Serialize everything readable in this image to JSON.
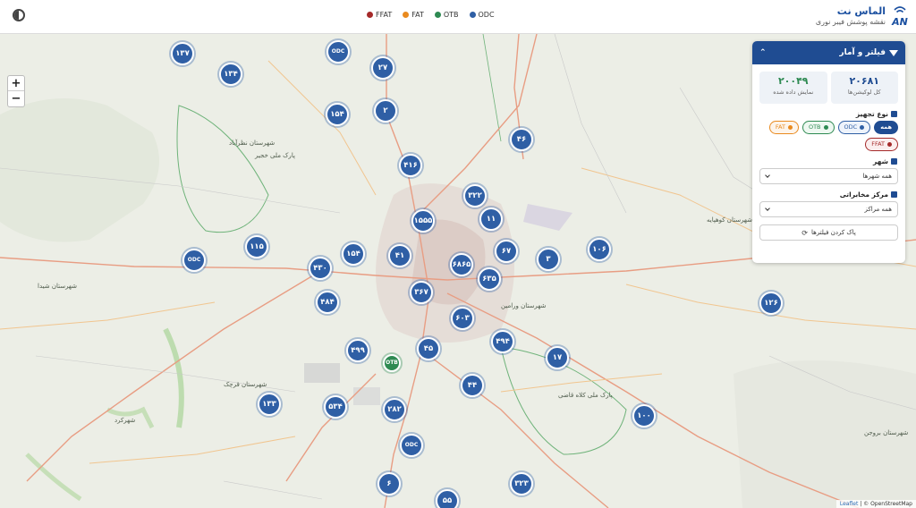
{
  "header": {
    "app_name": "الماس نت",
    "subtitle": "نقشه پوشش فیبر نوری",
    "logo_text": "AN",
    "legend": [
      {
        "label": "ODC",
        "color": "#2f5fa5"
      },
      {
        "label": "OTB",
        "color": "#2e8a52"
      },
      {
        "label": "FAT",
        "color": "#e98a1f"
      },
      {
        "label": "FFAT",
        "color": "#a52a2a"
      }
    ]
  },
  "map": {
    "zoom_in": "+",
    "zoom_out": "−",
    "attribution_leaflet": "Leaflet",
    "attribution_rest": "| © OpenStreetMap",
    "clusters": [
      {
        "label": "۱۳۷",
        "type": "cluster"
      },
      {
        "label": "ODC",
        "type": "odc"
      },
      {
        "label": "۲۷",
        "type": "cluster"
      },
      {
        "label": "۱۳۴",
        "type": "cluster"
      },
      {
        "label": "۲",
        "type": "cluster"
      },
      {
        "label": "۱۵۴",
        "type": "cluster"
      },
      {
        "label": "۴۶",
        "type": "cluster"
      },
      {
        "label": "۴۱۶",
        "type": "cluster"
      },
      {
        "label": "۳۲۲",
        "type": "cluster"
      },
      {
        "label": "۱۱",
        "type": "cluster"
      },
      {
        "label": "۱۵۵۵",
        "type": "cluster"
      },
      {
        "label": "۱۱۵",
        "type": "cluster"
      },
      {
        "label": "ODC",
        "type": "odc"
      },
      {
        "label": "۱۵۴",
        "type": "cluster"
      },
      {
        "label": "۴۱",
        "type": "cluster"
      },
      {
        "label": "۶۸۶۵",
        "type": "cluster"
      },
      {
        "label": "۶۷",
        "type": "cluster"
      },
      {
        "label": "۳",
        "type": "cluster"
      },
      {
        "label": "۱۰۶",
        "type": "cluster"
      },
      {
        "label": "۴۳۰",
        "type": "cluster"
      },
      {
        "label": "۶۳۵",
        "type": "cluster"
      },
      {
        "label": "۳۶۷",
        "type": "cluster"
      },
      {
        "label": "۴۸۴",
        "type": "cluster"
      },
      {
        "label": "۱۲۶",
        "type": "cluster"
      },
      {
        "label": "۶۰۳",
        "type": "cluster"
      },
      {
        "label": "۴۹۴",
        "type": "cluster"
      },
      {
        "label": "۴۹۹",
        "type": "cluster"
      },
      {
        "label": "۴۵",
        "type": "cluster"
      },
      {
        "label": "OTB",
        "type": "otb"
      },
      {
        "label": "۱۷",
        "type": "cluster"
      },
      {
        "label": "۴۴",
        "type": "cluster"
      },
      {
        "label": "۱۳۳",
        "type": "cluster"
      },
      {
        "label": "۵۳۴",
        "type": "cluster"
      },
      {
        "label": "۲۸۲",
        "type": "cluster"
      },
      {
        "label": "۱۰۰",
        "type": "cluster"
      },
      {
        "label": "ODC",
        "type": "odc"
      },
      {
        "label": "۶",
        "type": "cluster"
      },
      {
        "label": "۳۲۳",
        "type": "cluster"
      },
      {
        "label": "۵۵",
        "type": "cluster"
      }
    ],
    "places": [
      {
        "label": "شهرستان نظرآباد"
      },
      {
        "label": "پارک ملی خجیر"
      },
      {
        "label": "شهرستان ورامین"
      },
      {
        "label": "شهرستان کوهپایه"
      },
      {
        "label": "شهرکرد"
      },
      {
        "label": "شهرستان قرچک"
      },
      {
        "label": "پارک ملی کلاه قاضی"
      },
      {
        "label": "شهرستان بروجن"
      },
      {
        "label": "شهرستان شیدا"
      }
    ]
  },
  "panel": {
    "title": "فیلتر و آمار",
    "stats": {
      "total_value": "۲۰۶۸۱",
      "total_label": "کل لوکیشن‌ها",
      "shown_value": "۲۰۰۴۹",
      "shown_label": "نمایش داده شده"
    },
    "equipment_title": "نوع تجهیز",
    "chips": {
      "all": "همه",
      "odc": "ODC",
      "otb": "OTB",
      "fat": "FAT",
      "ffat": "FFAT"
    },
    "city_title": "شهر",
    "city_value": "همه شهرها",
    "center_title": "مرکز مخابراتی",
    "center_value": "همه مراکز",
    "clear_label": "پاک کردن فیلترها"
  }
}
